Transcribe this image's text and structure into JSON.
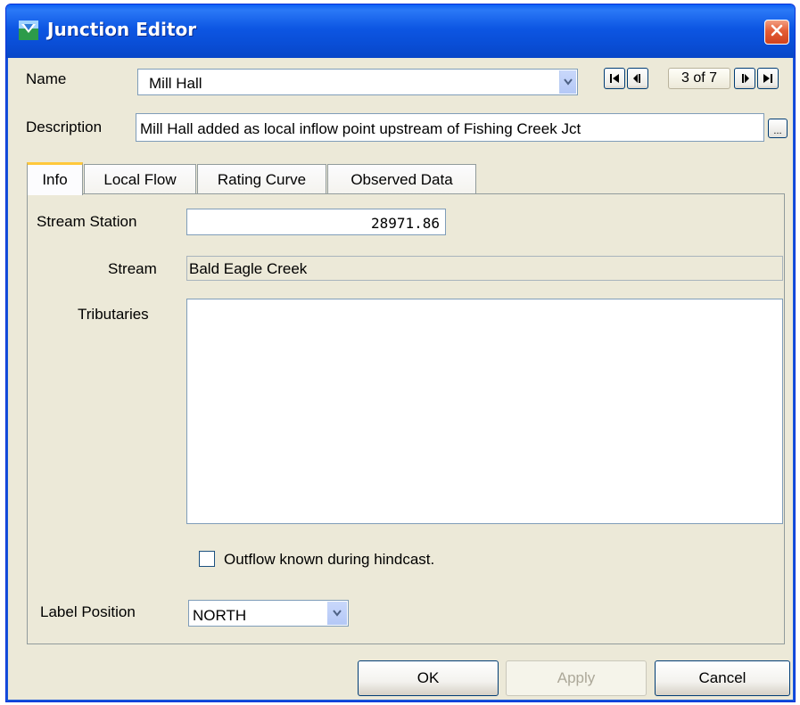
{
  "window": {
    "title": "Junction Editor",
    "icons": {
      "app": "junction-app-icon",
      "close": "close-icon"
    }
  },
  "name_row": {
    "label": "Name",
    "value": "Mill Hall",
    "navigation": {
      "position_text": "3 of 7",
      "icons": [
        "first-record-icon",
        "previous-record-icon",
        "next-record-icon",
        "last-record-icon"
      ]
    }
  },
  "description_row": {
    "label": "Description",
    "value": "Mill Hall added as local inflow point upstream of Fishing Creek Jct",
    "browse_icon": "ellipsis-icon"
  },
  "tabs": [
    {
      "label": "Info",
      "active": true
    },
    {
      "label": "Local Flow",
      "active": false
    },
    {
      "label": "Rating Curve",
      "active": false
    },
    {
      "label": "Observed Data",
      "active": false
    }
  ],
  "info": {
    "stream_station_label": "Stream Station",
    "stream_station_value": "28971.86",
    "stream_label": "Stream",
    "stream_value": "Bald Eagle Creek",
    "tributaries_label": "Tributaries",
    "tributaries_value": "",
    "outflow_checkbox_label": "Outflow known during hindcast.",
    "outflow_checked": false,
    "label_position_label": "Label Position",
    "label_position_value": "NORTH"
  },
  "buttons": {
    "ok": "OK",
    "apply": "Apply",
    "cancel": "Cancel"
  },
  "colors": {
    "titlebar": "#0a4fd8",
    "dialog_background": "#ece9d8",
    "active_tab_highlight": "#ffc83c",
    "close_button": "#e45d36"
  }
}
